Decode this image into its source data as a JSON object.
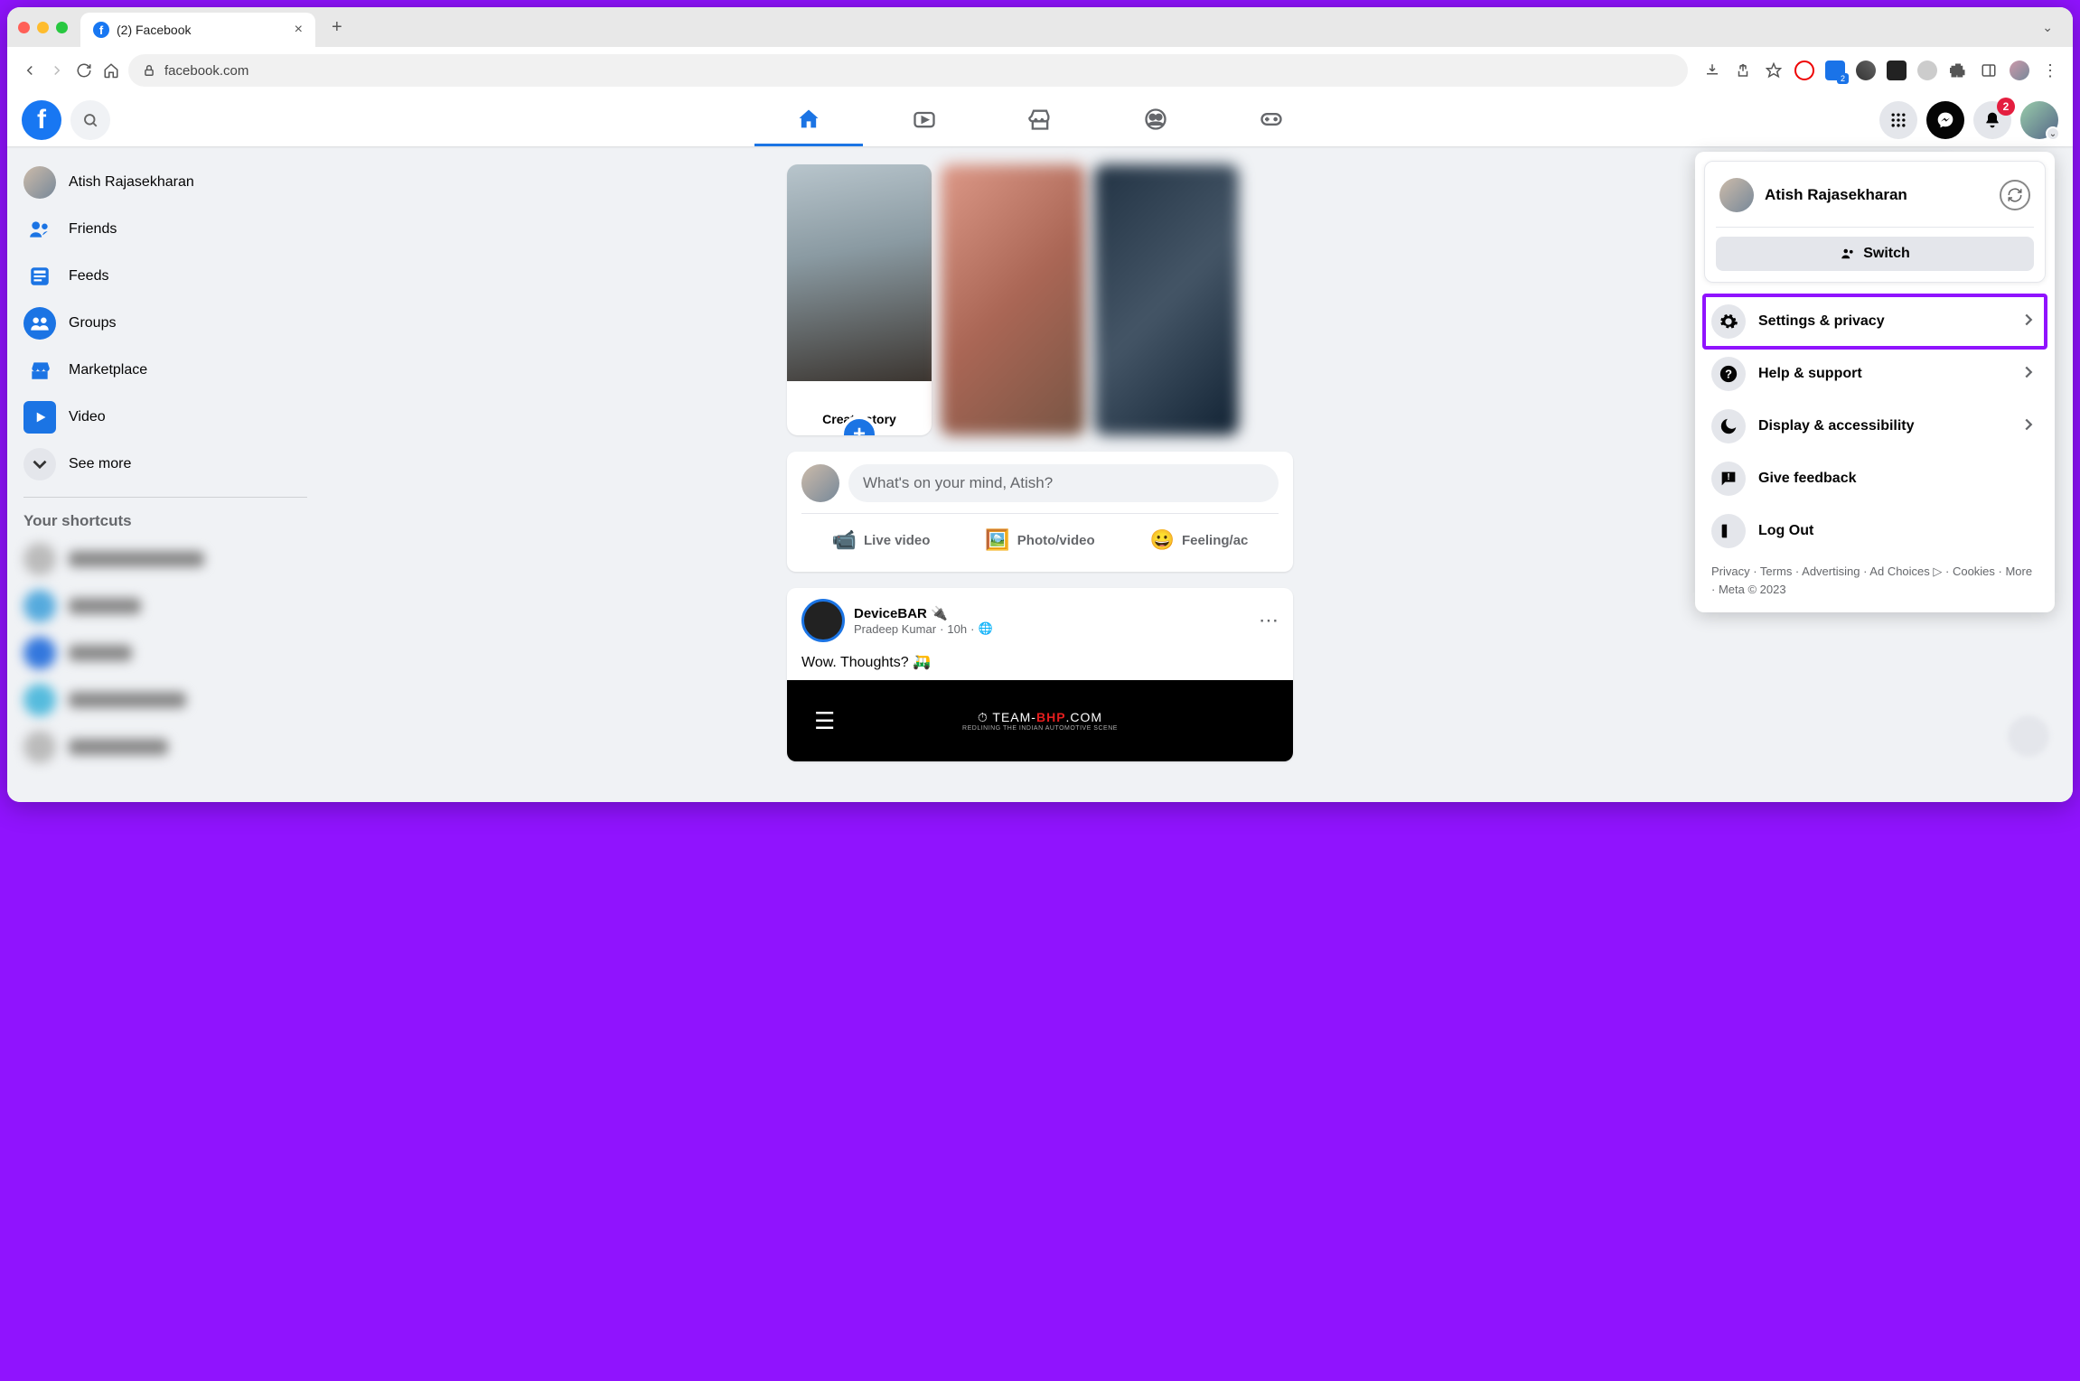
{
  "browser": {
    "tab_title": "(2) Facebook",
    "url": "facebook.com"
  },
  "user": {
    "name": "Atish Rajasekharan",
    "short": "Atish"
  },
  "notifications": {
    "count": "2"
  },
  "sidebar": {
    "items": [
      {
        "label": "Atish Rajasekharan",
        "icon": "avatar"
      },
      {
        "label": "Friends",
        "icon": "friends"
      },
      {
        "label": "Feeds",
        "icon": "feeds"
      },
      {
        "label": "Groups",
        "icon": "groups"
      },
      {
        "label": "Marketplace",
        "icon": "marketplace"
      },
      {
        "label": "Video",
        "icon": "video"
      },
      {
        "label": "See more",
        "icon": "more"
      }
    ],
    "shortcuts_heading": "Your shortcuts"
  },
  "story": {
    "create_label": "Create story"
  },
  "composer": {
    "placeholder": "What's on your mind, Atish?",
    "live": "Live video",
    "photo": "Photo/video",
    "feeling": "Feeling/ac"
  },
  "post": {
    "page": "DeviceBAR 🔌",
    "author": "Pradeep Kumar",
    "time": "10h",
    "text": "Wow. Thoughts? 🛺",
    "brand_a": "TEAM-",
    "brand_b": "BHP",
    "brand_c": ".COM",
    "brand_sub": "REDLINING THE INDIAN AUTOMOTIVE SCENE"
  },
  "menu": {
    "name": "Atish Rajasekharan",
    "switch": "Switch",
    "items": [
      {
        "label": "Settings & privacy",
        "icon": "gear",
        "chevron": true,
        "highlight": true
      },
      {
        "label": "Help & support",
        "icon": "help",
        "chevron": true
      },
      {
        "label": "Display & accessibility",
        "icon": "moon",
        "chevron": true
      },
      {
        "label": "Give feedback",
        "icon": "feedback"
      },
      {
        "label": "Log Out",
        "icon": "logout"
      }
    ],
    "footer": "Privacy · Terms · Advertising · Ad Choices ▷ · Cookies · More · Meta © 2023"
  }
}
